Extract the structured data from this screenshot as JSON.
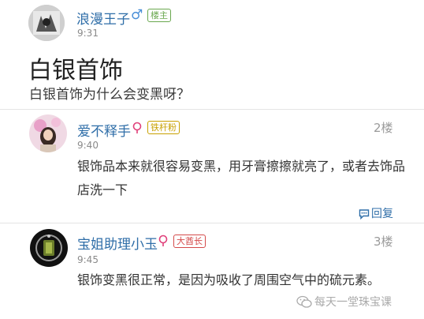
{
  "original_post": {
    "author": "浪漫王子",
    "gender_symbol": "♂",
    "badge": "楼主",
    "time": "9:31",
    "title": "白银首饰",
    "question": "白银首饰为什么会变黑呀？"
  },
  "replies": [
    {
      "author": "爱不释手",
      "badge": "铁杆粉",
      "time": "9:40",
      "floor": "2楼",
      "content": "银饰品本来就很容易变黑，用牙膏擦擦就亮了，或者去饰品店洗一下",
      "reply_label": "回复"
    },
    {
      "author": "宝姐助理小玉",
      "badge": "大酋长",
      "time": "9:45",
      "floor": "3楼",
      "content": "银饰变黑很正常，是因为吸收了周围空气中的硫元素。"
    }
  ],
  "watermark": "每天一堂珠宝课",
  "colors": {
    "name": "#2f6ea8",
    "host_badge": "#6aa84f",
    "fan_badge": "#c8a000",
    "chief_badge": "#d44a4a",
    "gender_male": "#4a8fd8",
    "level_icon": "#e0407a"
  },
  "icons": {
    "gender": "male-symbol-icon",
    "level": "level-flower-icon",
    "reply": "comment-bubble-icon",
    "watermark": "wechat-icon"
  }
}
